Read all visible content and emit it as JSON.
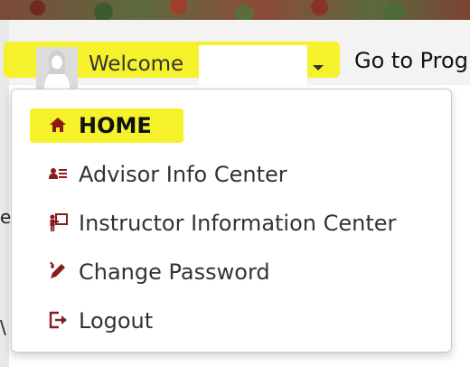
{
  "header": {
    "welcome_label": "Welcome",
    "goto_label": "Go to Prog"
  },
  "menu": {
    "items": [
      {
        "label": "HOME",
        "icon": "home-icon"
      },
      {
        "label": "Advisor Info Center",
        "icon": "advisor-icon"
      },
      {
        "label": "Instructor Information Center",
        "icon": "instructor-icon"
      },
      {
        "label": "Change Password",
        "icon": "key-pencil-icon"
      },
      {
        "label": "Logout",
        "icon": "logout-icon"
      }
    ]
  },
  "colors": {
    "icon": "#8b1a1a",
    "highlight": "#f5f12a"
  }
}
